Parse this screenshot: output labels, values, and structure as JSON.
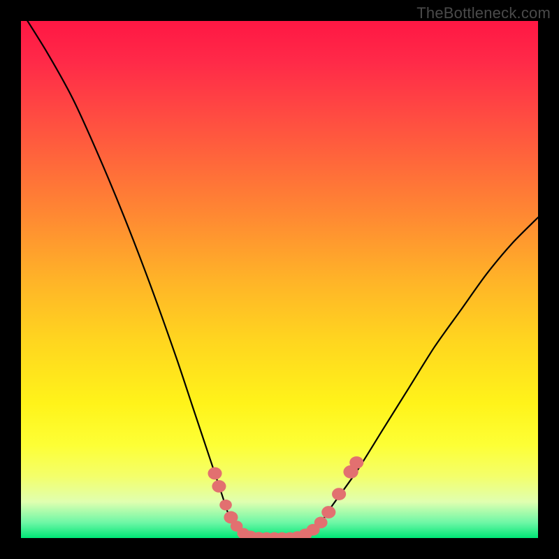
{
  "watermark": "TheBottleneck.com",
  "colors": {
    "background": "#000000",
    "curve": "#000000",
    "marker_fill": "#e27070",
    "marker_stroke": "#c75a5a"
  },
  "chart_data": {
    "type": "line",
    "title": "",
    "xlabel": "",
    "ylabel": "",
    "xlim": [
      0,
      100
    ],
    "ylim": [
      0,
      100
    ],
    "grid": false,
    "legend": false,
    "annotations": [],
    "series": [
      {
        "name": "bottleneck-curve",
        "x": [
          0,
          5,
          10,
          15,
          20,
          25,
          30,
          33,
          35,
          36,
          37,
          38,
          39,
          40,
          42,
          44,
          46,
          48,
          50,
          52,
          54,
          56,
          58,
          60,
          65,
          70,
          75,
          80,
          85,
          90,
          95,
          100
        ],
        "y": [
          102,
          94,
          85,
          74,
          62,
          49,
          35,
          26,
          20,
          17,
          14,
          11,
          8,
          5,
          2,
          0.8,
          0.2,
          0,
          0,
          0,
          0.4,
          1.2,
          3,
          6,
          13,
          21,
          29,
          37,
          44,
          51,
          57,
          62
        ]
      }
    ],
    "markers": [
      {
        "x": 37.5,
        "y": 12.5,
        "r": 1.6
      },
      {
        "x": 38.3,
        "y": 10.0,
        "r": 1.6
      },
      {
        "x": 39.6,
        "y": 6.4,
        "r": 1.4
      },
      {
        "x": 40.6,
        "y": 4.0,
        "r": 1.6
      },
      {
        "x": 41.7,
        "y": 2.3,
        "r": 1.4
      },
      {
        "x": 43.0,
        "y": 0.9,
        "r": 1.4
      },
      {
        "x": 44.4,
        "y": 0.3,
        "r": 1.5
      },
      {
        "x": 46.0,
        "y": 0.05,
        "r": 1.5
      },
      {
        "x": 47.5,
        "y": 0.0,
        "r": 1.5
      },
      {
        "x": 49.0,
        "y": 0.0,
        "r": 1.5
      },
      {
        "x": 50.5,
        "y": 0.0,
        "r": 1.5
      },
      {
        "x": 52.0,
        "y": 0.0,
        "r": 1.5
      },
      {
        "x": 53.5,
        "y": 0.2,
        "r": 1.5
      },
      {
        "x": 55.0,
        "y": 0.7,
        "r": 1.5
      },
      {
        "x": 56.5,
        "y": 1.6,
        "r": 1.5
      },
      {
        "x": 58.0,
        "y": 3.0,
        "r": 1.5
      },
      {
        "x": 59.5,
        "y": 5.0,
        "r": 1.6
      },
      {
        "x": 61.5,
        "y": 8.5,
        "r": 1.6
      },
      {
        "x": 63.8,
        "y": 12.8,
        "r": 1.7
      },
      {
        "x": 64.9,
        "y": 14.6,
        "r": 1.6
      }
    ]
  }
}
